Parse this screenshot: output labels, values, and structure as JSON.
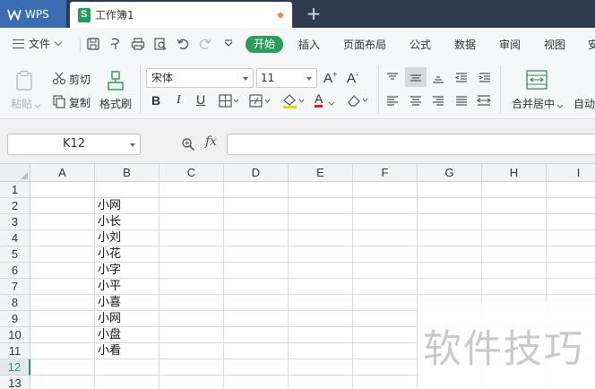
{
  "titlebar": {
    "app_tab": "WPS",
    "doc_tab": "工作簿1",
    "new_tab_glyph": "+",
    "colors": {
      "bg": "#2f3c4f",
      "app_tab": "#3b6db3",
      "modified_dot": "#f08a3b"
    }
  },
  "menubar": {
    "file_label": "文件",
    "tabs": [
      "开始",
      "插入",
      "页面布局",
      "公式",
      "数据",
      "审阅",
      "视图",
      "安"
    ],
    "active_tab": "开始",
    "accent": "#2a9d5a",
    "quick_access_icons": [
      "save-icon",
      "format-painter-icon",
      "print-icon",
      "print-preview-icon",
      "undo-icon",
      "redo-icon",
      "customize-dropdown-icon"
    ]
  },
  "ribbon": {
    "paste_label": "粘贴",
    "cut_label": "剪切",
    "copy_label": "复制",
    "format_painter_label": "格式刷",
    "font_name": "宋体",
    "font_size": "11",
    "grow_font_glyph": "A",
    "shrink_font_glyph": "A",
    "bold_glyph": "B",
    "italic_glyph": "I",
    "underline_glyph": "U",
    "font_color_glyph": "A",
    "merge_center_label": "合并居中",
    "auto_wrap_label": "自动"
  },
  "formula_bar": {
    "name_box": "K12",
    "fx_label": "fx",
    "formula_value": ""
  },
  "sheet": {
    "columns": [
      "A",
      "B",
      "C",
      "D",
      "E",
      "F",
      "G",
      "H",
      "I"
    ],
    "rows": [
      "1",
      "2",
      "3",
      "4",
      "5",
      "6",
      "7",
      "8",
      "9",
      "10",
      "11",
      "12",
      "13"
    ],
    "active_row": "12",
    "column_b_values": [
      "",
      "小网",
      "小长",
      "小刘",
      "小花",
      "小字",
      "小平",
      "小喜",
      "小网",
      "小盘",
      "小看",
      "",
      ""
    ]
  },
  "watermark": "软件技巧"
}
